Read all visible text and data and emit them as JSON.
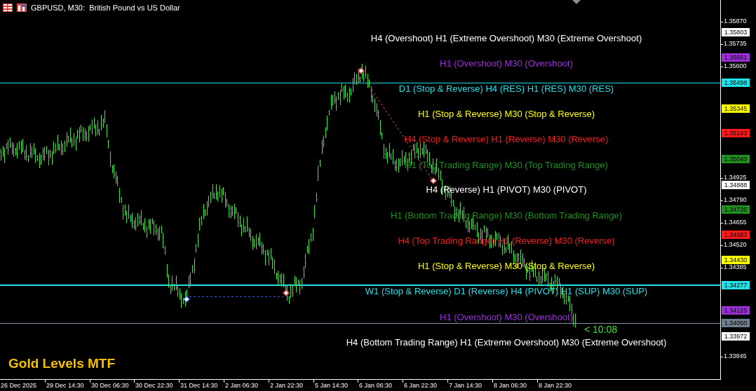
{
  "window": {
    "title": "GBPUSD, M30:  British Pound vs US Dollar"
  },
  "levels": [
    {
      "text": "H4 (Overshoot) H1 (Extreme Overshoot) M30 (Extreme Overshoot)",
      "color": "#ffffff"
    },
    {
      "text": "H1 (Overshoot) M30 (Overshoot)",
      "color": "#9b30d9"
    },
    {
      "text": "D1 (Stop & Reverse) H4 (RES) H1 (RES) M30 (RES)",
      "color": "#22e0e8"
    },
    {
      "text": "H1 (Stop & Reverse) M30 (Stop & Reverse)",
      "color": "#ffff00"
    },
    {
      "text": "H4 (Stop & Reverse) H1 (Reverse) M30 (Reverse)",
      "color": "#ff1a1a"
    },
    {
      "text": "H1 (Top Trading Range) M30 (Top Trading Range)",
      "color": "#1f8f1f"
    },
    {
      "text": "H4 (Reverse) H1 (PIVOT) M30 (PIVOT)",
      "color": "#ffffff"
    },
    {
      "text": "H1 (Bottom Trading Range) M30 (Bottom Trading Range)",
      "color": "#1f8f1f"
    },
    {
      "text": "H4 (Top Trading Range) H1 (Reverse) M30 (Reverse)",
      "color": "#ff1a1a"
    },
    {
      "text": "H1 (Stop & Reverse) M30 (Stop & Reverse)",
      "color": "#ffff00"
    },
    {
      "text": "W1 (Stop & Reverse) D1 (Reverse) H4 (PIVOT) H1 (SUP) M30 (SUP)",
      "color": "#22e0e8"
    },
    {
      "text": "H1 (Overshoot) M30 (Overshoot)",
      "color": "#9b30d9"
    },
    {
      "text": "H4 (Bottom Trading Range) H1 (Extreme Overshoot) M30 (Extreme Overshoot)",
      "color": "#ffffff"
    }
  ],
  "countdown": "< 10:08",
  "indicator_name": "Gold Levels MTF",
  "price_axis": {
    "ticks": [
      "1.35870",
      "1.35735",
      "1.35600",
      "1.34925",
      "1.34790",
      "1.34655",
      "1.34520",
      "1.34385",
      "1.33845"
    ],
    "labels": [
      {
        "text": "1.35803",
        "color": "#ffffff"
      },
      {
        "text": "1.35651",
        "color": "#9b30d9"
      },
      {
        "text": "1.35498",
        "color": "#22e0e8"
      },
      {
        "text": "1.35345",
        "color": "#ffff00"
      },
      {
        "text": "1.35193",
        "color": "#ff1a1a"
      },
      {
        "text": "1.35040",
        "color": "#1f8f1f"
      },
      {
        "text": "1.34888",
        "color": "#ffffff"
      },
      {
        "text": "1.34735",
        "color": "#1f8f1f"
      },
      {
        "text": "1.34583",
        "color": "#ff1a1a"
      },
      {
        "text": "1.34430",
        "color": "#ffff00"
      },
      {
        "text": "1.34277",
        "color": "#22e0e8"
      },
      {
        "text": "1.34125",
        "color": "#9b30d9"
      },
      {
        "text": "1.34050",
        "color": "#708090"
      },
      {
        "text": "1.33972",
        "color": "#ffffff"
      }
    ]
  },
  "time_axis": [
    "26 Dec 2025",
    "29 Dec 14:30",
    "30 Dec 06:30",
    "30 Dec 22:30",
    "31 Dec 14:30",
    "2 Jan 06:30",
    "2 Jan 22:30",
    "5 Jan 14:30",
    "6 Jan 06:30",
    "6 Jan 22:30",
    "7 Jan 14:30",
    "8 Jan 06:30",
    "8 Jan 22:30"
  ]
}
